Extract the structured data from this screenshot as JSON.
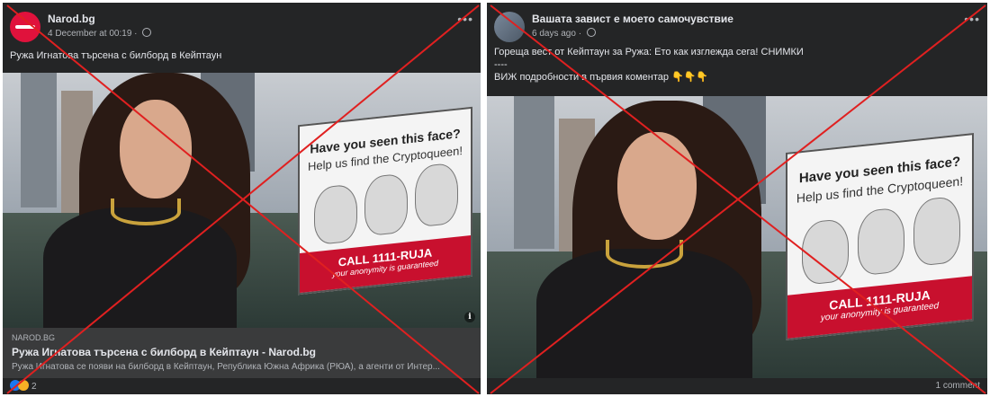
{
  "posts": [
    {
      "author": "Narod.bg",
      "timestamp": "4 December at 00:19",
      "caption": "Ружа Игнатова търсена с билборд в Кейптаун",
      "billboard": {
        "title": "Have you seen this face?",
        "subtitle": "Help us find the Cryptoqueen!",
        "call": "CALL 1111-RUJA",
        "anonymity": "your anonymity is guaranteed"
      },
      "link": {
        "domain": "NAROD.BG",
        "title": "Ружа Игнатова търсена с билборд в Кейптаун - Narod.bg",
        "description": "Ружа Игнатова се появи на билборд в Кейптаун, Република Южна Африка (РЮА), а агенти от Интер..."
      },
      "reactions": {
        "count": "2",
        "icons": [
          "like-icon",
          "haha-icon"
        ]
      }
    },
    {
      "author": "Вашата завист е моето самочувствие",
      "timestamp": "6 days ago",
      "caption_lines": [
        "Гореща вест от Кейптаун за Ружа: Ето как изглежда сега! СНИМКИ",
        "----",
        "ВИЖ подробности в първия коментар 👇👇👇"
      ],
      "billboard": {
        "title": "Have you seen this face?",
        "subtitle": "Help us find the Cryptoqueen!",
        "call": "CALL 1111-RUJA",
        "anonymity": "your anonymity is guaranteed"
      },
      "comments": "1 comment"
    }
  ],
  "overlay": {
    "mark_color": "#e02020"
  },
  "theme": {
    "card_bg": "#242526",
    "text": "#e4e6eb",
    "muted": "#b0b3b8",
    "billboard_red": "#c8102e"
  }
}
